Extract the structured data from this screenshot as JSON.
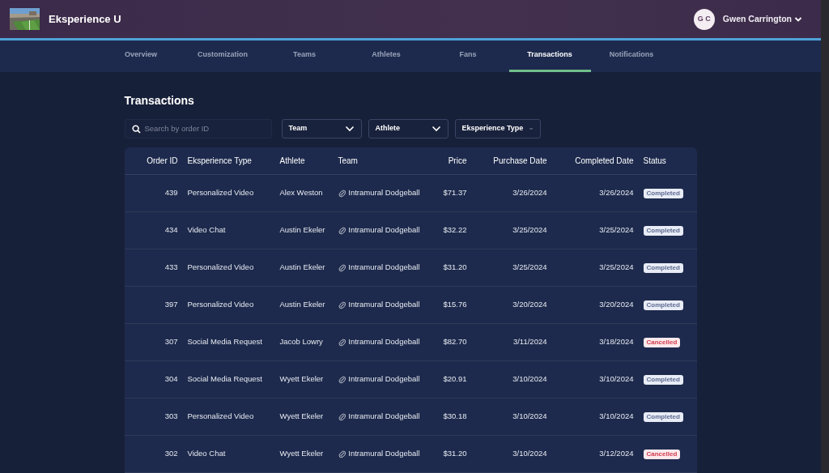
{
  "brand": {
    "name": "Eksperience U"
  },
  "user": {
    "initials": "G C",
    "name": "Gwen Carrington"
  },
  "tabs": [
    {
      "label": "Overview",
      "selected": false
    },
    {
      "label": "Customization",
      "selected": false
    },
    {
      "label": "Teams",
      "selected": false
    },
    {
      "label": "Athletes",
      "selected": false
    },
    {
      "label": "Fans",
      "selected": false
    },
    {
      "label": "Transactions",
      "selected": true
    },
    {
      "label": "Notifications",
      "selected": false
    }
  ],
  "page_title": "Transactions",
  "search": {
    "placeholder": "Search by order ID"
  },
  "filters": [
    "Team",
    "Athlete",
    "Eksperience Type"
  ],
  "table": {
    "columns": [
      "Order ID",
      "Eksperience Type",
      "Athlete",
      "Team",
      "Price",
      "Purchase Date",
      "Completed Date",
      "Status"
    ],
    "rows": [
      {
        "order_id": "439",
        "type": "Personalized Video",
        "athlete": "Alex Weston",
        "team": "Intramural Dodgeball",
        "price": "$71.37",
        "purchase_date": "3/26/2024",
        "completed_date": "3/26/2024",
        "status": "Completed",
        "kind": "completed"
      },
      {
        "order_id": "434",
        "type": "Video Chat",
        "athlete": "Austin Ekeler",
        "team": "Intramural Dodgeball",
        "price": "$32.22",
        "purchase_date": "3/25/2024",
        "completed_date": "3/25/2024",
        "status": "Completed",
        "kind": "completed"
      },
      {
        "order_id": "433",
        "type": "Personalized Video",
        "athlete": "Austin Ekeler",
        "team": "Intramural Dodgeball",
        "price": "$31.20",
        "purchase_date": "3/25/2024",
        "completed_date": "3/25/2024",
        "status": "Completed",
        "kind": "completed"
      },
      {
        "order_id": "397",
        "type": "Personalized Video",
        "athlete": "Austin Ekeler",
        "team": "Intramural Dodgeball",
        "price": "$15.76",
        "purchase_date": "3/20/2024",
        "completed_date": "3/20/2024",
        "status": "Completed",
        "kind": "completed"
      },
      {
        "order_id": "307",
        "type": "Social Media Request",
        "athlete": "Jacob Lowry",
        "team": "Intramural Dodgeball",
        "price": "$82.70",
        "purchase_date": "3/11/2024",
        "completed_date": "3/18/2024",
        "status": "Cancelled",
        "kind": "cancelled"
      },
      {
        "order_id": "304",
        "type": "Social Media Request",
        "athlete": "Wyett Ekeler",
        "team": "Intramural Dodgeball",
        "price": "$20.91",
        "purchase_date": "3/10/2024",
        "completed_date": "3/10/2024",
        "status": "Completed",
        "kind": "completed"
      },
      {
        "order_id": "303",
        "type": "Personalized Video",
        "athlete": "Wyett Ekeler",
        "team": "Intramural Dodgeball",
        "price": "$30.18",
        "purchase_date": "3/10/2024",
        "completed_date": "3/10/2024",
        "status": "Completed",
        "kind": "completed"
      },
      {
        "order_id": "302",
        "type": "Video Chat",
        "athlete": "Wyett Ekeler",
        "team": "Intramural Dodgeball",
        "price": "$31.20",
        "purchase_date": "3/10/2024",
        "completed_date": "3/12/2024",
        "status": "Cancelled",
        "kind": "cancelled"
      }
    ]
  }
}
